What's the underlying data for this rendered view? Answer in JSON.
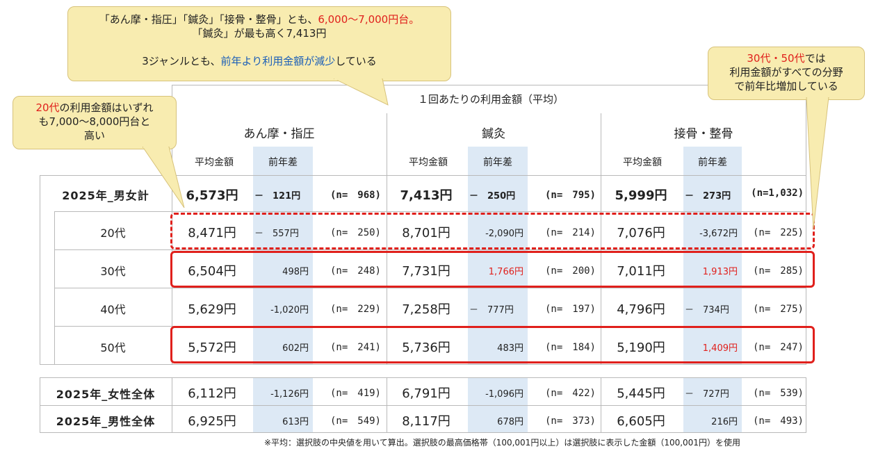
{
  "header": {
    "title": "１回あたりの利用金額（平均）",
    "genres": [
      "あん摩・指圧",
      "鍼灸",
      "接骨・整骨"
    ],
    "col_avg": "平均金額",
    "col_diff": "前年差"
  },
  "rows": {
    "total": {
      "label": "2025年_男女計",
      "cells": [
        [
          "6,573円",
          "－　121円",
          "(n=　968)"
        ],
        [
          "7,413円",
          "－　250円",
          "(n=　795)"
        ],
        [
          "5,999円",
          "－　273円",
          "(n=1,032)"
        ]
      ]
    },
    "age20": {
      "label": "20代",
      "cells": [
        [
          "8,471円",
          "－　557円",
          "(n=　250)"
        ],
        [
          "8,701円",
          "-2,090円",
          "(n=　214)"
        ],
        [
          "7,076円",
          "-3,672円",
          "(n=　225)"
        ]
      ]
    },
    "age30": {
      "label": "30代",
      "cells": [
        [
          "6,504円",
          "498円",
          "(n=　248)"
        ],
        [
          "7,731円",
          "1,766円",
          "(n=　200)"
        ],
        [
          "7,011円",
          "1,913円",
          "(n=　285)"
        ]
      ]
    },
    "age40": {
      "label": "40代",
      "cells": [
        [
          "5,629円",
          "-1,020円",
          "(n=　229)"
        ],
        [
          "7,258円",
          "－　777円",
          "(n=　197)"
        ],
        [
          "4,796円",
          "－　734円",
          "(n=　275)"
        ]
      ]
    },
    "age50": {
      "label": "50代",
      "cells": [
        [
          "5,572円",
          "602円",
          "(n=　241)"
        ],
        [
          "5,736円",
          "483円",
          "(n=　184)"
        ],
        [
          "5,190円",
          "1,409円",
          "(n=　247)"
        ]
      ]
    },
    "female": {
      "label": "2025年_女性全体",
      "cells": [
        [
          "6,112円",
          "-1,126円",
          "(n=　419)"
        ],
        [
          "6,791円",
          "-1,096円",
          "(n=　422)"
        ],
        [
          "5,445円",
          "－　727円",
          "(n=　539)"
        ]
      ]
    },
    "male": {
      "label": "2025年_男性全体",
      "cells": [
        [
          "6,925円",
          "613円",
          "(n=　549)"
        ],
        [
          "8,117円",
          "678円",
          "(n=　373)"
        ],
        [
          "6,605円",
          "216円",
          "(n=　493)"
        ]
      ]
    }
  },
  "callouts": {
    "top": {
      "line1_pre": "「あん摩・指圧」「鍼灸」「接骨・整骨」とも、",
      "line1_red": "6,000～7,000円台。",
      "line2": "「鍼灸」が最も高く7,413円",
      "line3_pre": "3ジャンルとも、",
      "line3_blue": "前年より利用金額が減少",
      "line3_post": "している"
    },
    "left": {
      "red": "20代",
      "text1": "の利用金額はいずれ",
      "text2": "も7,000～8,000円台と",
      "text3": "高い"
    },
    "right": {
      "red": "30代・50代",
      "text0": "では",
      "text1": "利用金額がすべての分野",
      "text2": "で前年比増加している"
    }
  },
  "footnote": "※平均：選択肢の中央値を用いて算出。選択肢の最高価格帯（100,001円以上）は選択肢に表示した金額（100,001円）を使用",
  "colors": {
    "callout_bg": "#f8ecb0",
    "shade": "#dde9f5",
    "highlight_red": "#e0201c",
    "highlight_blue": "#1c5fb8"
  }
}
